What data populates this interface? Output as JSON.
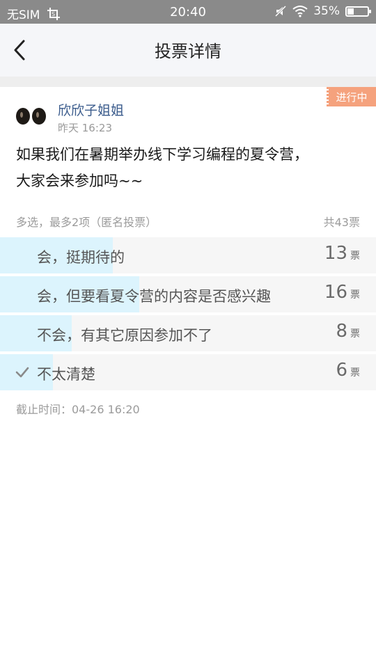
{
  "status": {
    "carrier": "无SIM",
    "time": "20:40",
    "battery": "35%"
  },
  "header": {
    "title": "投票详情",
    "back_icon": "back-arrow-icon"
  },
  "post": {
    "badge": "进行中",
    "author": "欣欣子姐姐",
    "time": "昨天 16:23",
    "question_line1": "如果我们在暑期举办线下学习编程的夏令营，",
    "question_line2": "大家会来参加吗~~"
  },
  "poll": {
    "meta": "多选，最多2项（匿名投票）",
    "total": "共43票",
    "unit": "票",
    "options": [
      {
        "label": "会，挺期待的",
        "count": "13",
        "fraction": 0.3,
        "checked": false
      },
      {
        "label": "会，但要看夏令营的内容是否感兴趣",
        "count": "16",
        "fraction": 0.37,
        "checked": false
      },
      {
        "label": "不会，有其它原因参加不了",
        "count": "8",
        "fraction": 0.19,
        "checked": false
      },
      {
        "label": "不太清楚",
        "count": "6",
        "fraction": 0.14,
        "checked": true
      }
    ],
    "deadline": "截止时间：04-26 16:20"
  },
  "colors": {
    "accent_badge": "#f5a27d",
    "bar_fill": "#dcf4fd",
    "author_link": "#3a5b8c"
  }
}
